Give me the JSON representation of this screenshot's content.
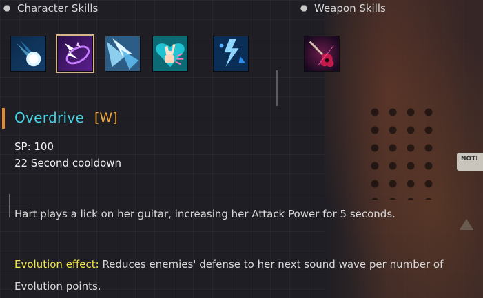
{
  "sections": {
    "character_skills": "Character Skills",
    "weapon_skills": "Weapon Skills"
  },
  "skills": {
    "character": [
      {
        "icon": "comet-skill-icon",
        "selected": false
      },
      {
        "icon": "overdrive-wave-icon",
        "selected": true
      },
      {
        "icon": "shard-burst-icon",
        "selected": false
      },
      {
        "icon": "rock-hand-heart-icon",
        "selected": false
      },
      {
        "icon": "lightning-burst-icon",
        "selected": false
      }
    ],
    "weapon": [
      {
        "icon": "guitar-icon",
        "selected": false
      }
    ]
  },
  "detail": {
    "name": "Overdrive",
    "key": "[W]",
    "sp": "SP: 100",
    "cooldown": "22 Second cooldown",
    "description": "Hart plays a lick on her guitar, increasing her Attack Power for 5 seconds.",
    "evolution_label": "Evolution effect:",
    "evolution_text": " Reduces enemies' defense to her next sound wave per number of Evolution points."
  },
  "background": {
    "sign_text": "NOTI"
  },
  "colors": {
    "title": "#46d3e6",
    "key": "#f2a93b",
    "evolution_label": "#f3e64a",
    "selection_border": "#d7b58a",
    "accent_bar": "#e08a2b"
  }
}
